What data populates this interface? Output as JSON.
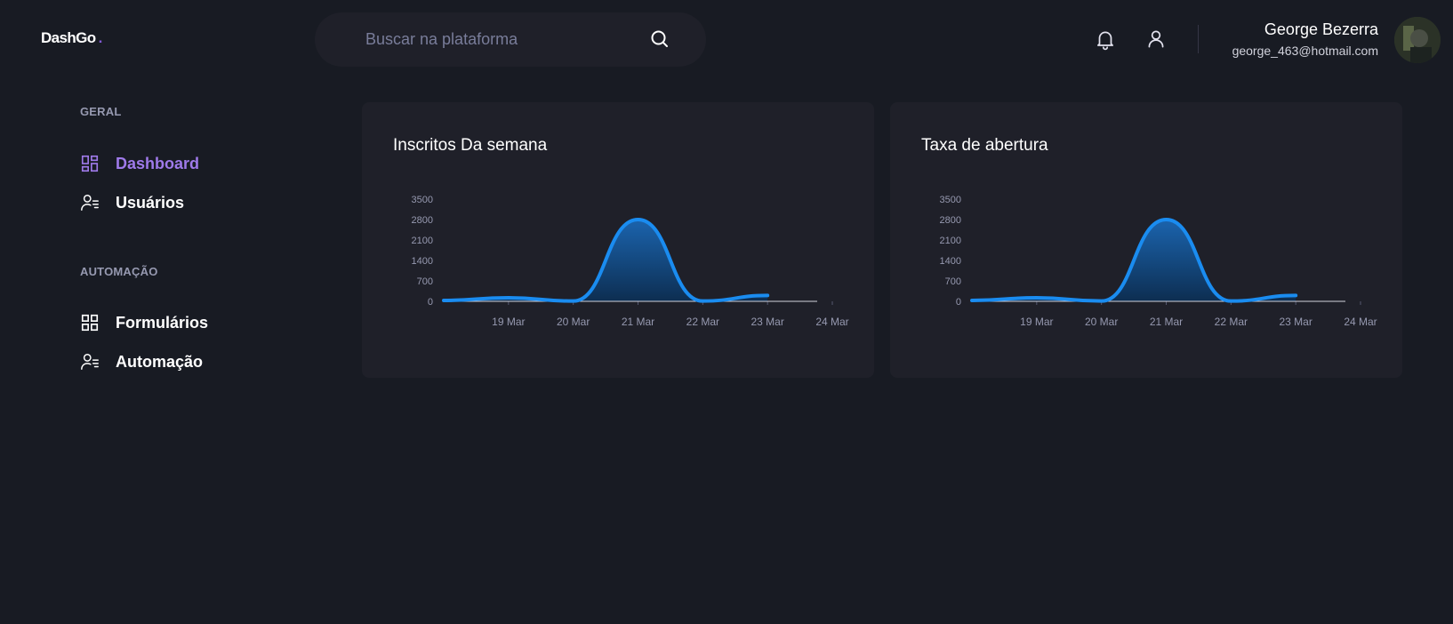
{
  "header": {
    "logo": "DashGo",
    "logo_dot": ".",
    "search_placeholder": "Buscar na plataforma",
    "profile": {
      "name": "George Bezerra",
      "email": "george_463@hotmail.com"
    }
  },
  "sidebar": {
    "sections": [
      {
        "title": "GERAL",
        "items": [
          {
            "label": "Dashboard",
            "icon": "dashboard-icon",
            "active": true
          },
          {
            "label": "Usuários",
            "icon": "users-icon",
            "active": false
          }
        ]
      },
      {
        "title": "AUTOMAÇÃO",
        "items": [
          {
            "label": "Formulários",
            "icon": "forms-icon",
            "active": false
          },
          {
            "label": "Automação",
            "icon": "automation-icon",
            "active": false
          }
        ]
      }
    ]
  },
  "colors": {
    "background": "#181b23",
    "card": "#1f2029",
    "accent": "#805ad5",
    "active_text": "#9f7aea",
    "series": "#1a8cf0"
  },
  "chart_data": [
    {
      "type": "area",
      "title": "Inscritos Da semana",
      "xlabel": "",
      "ylabel": "",
      "x_ticks": [
        "19 Mar",
        "20 Mar",
        "21 Mar",
        "22 Mar",
        "23 Mar",
        "24 Mar"
      ],
      "y_ticks": [
        "0",
        "700",
        "1400",
        "2100",
        "2800",
        "3500"
      ],
      "ylim": [
        0,
        3500
      ],
      "xlim": [
        "2021-03-18T00:00",
        "2021-03-24T00:00"
      ],
      "x": [
        "2021-03-18T00:00",
        "2021-03-19T00:00",
        "2021-03-20T00:00",
        "2021-03-21T00:00",
        "2021-03-22T00:00",
        "2021-03-23T00:00"
      ],
      "values": [
        31,
        120,
        10,
        2800,
        10,
        200
      ],
      "grid": false,
      "legend": false
    },
    {
      "type": "area",
      "title": "Taxa de abertura",
      "xlabel": "",
      "ylabel": "",
      "x_ticks": [
        "19 Mar",
        "20 Mar",
        "21 Mar",
        "22 Mar",
        "23 Mar",
        "24 Mar"
      ],
      "y_ticks": [
        "0",
        "700",
        "1400",
        "2100",
        "2800",
        "3500"
      ],
      "ylim": [
        0,
        3500
      ],
      "xlim": [
        "2021-03-18T00:00",
        "2021-03-24T00:00"
      ],
      "x": [
        "2021-03-18T00:00",
        "2021-03-19T00:00",
        "2021-03-20T00:00",
        "2021-03-21T00:00",
        "2021-03-22T00:00",
        "2021-03-23T00:00"
      ],
      "values": [
        31,
        120,
        10,
        2800,
        10,
        200
      ],
      "grid": false,
      "legend": false
    }
  ]
}
